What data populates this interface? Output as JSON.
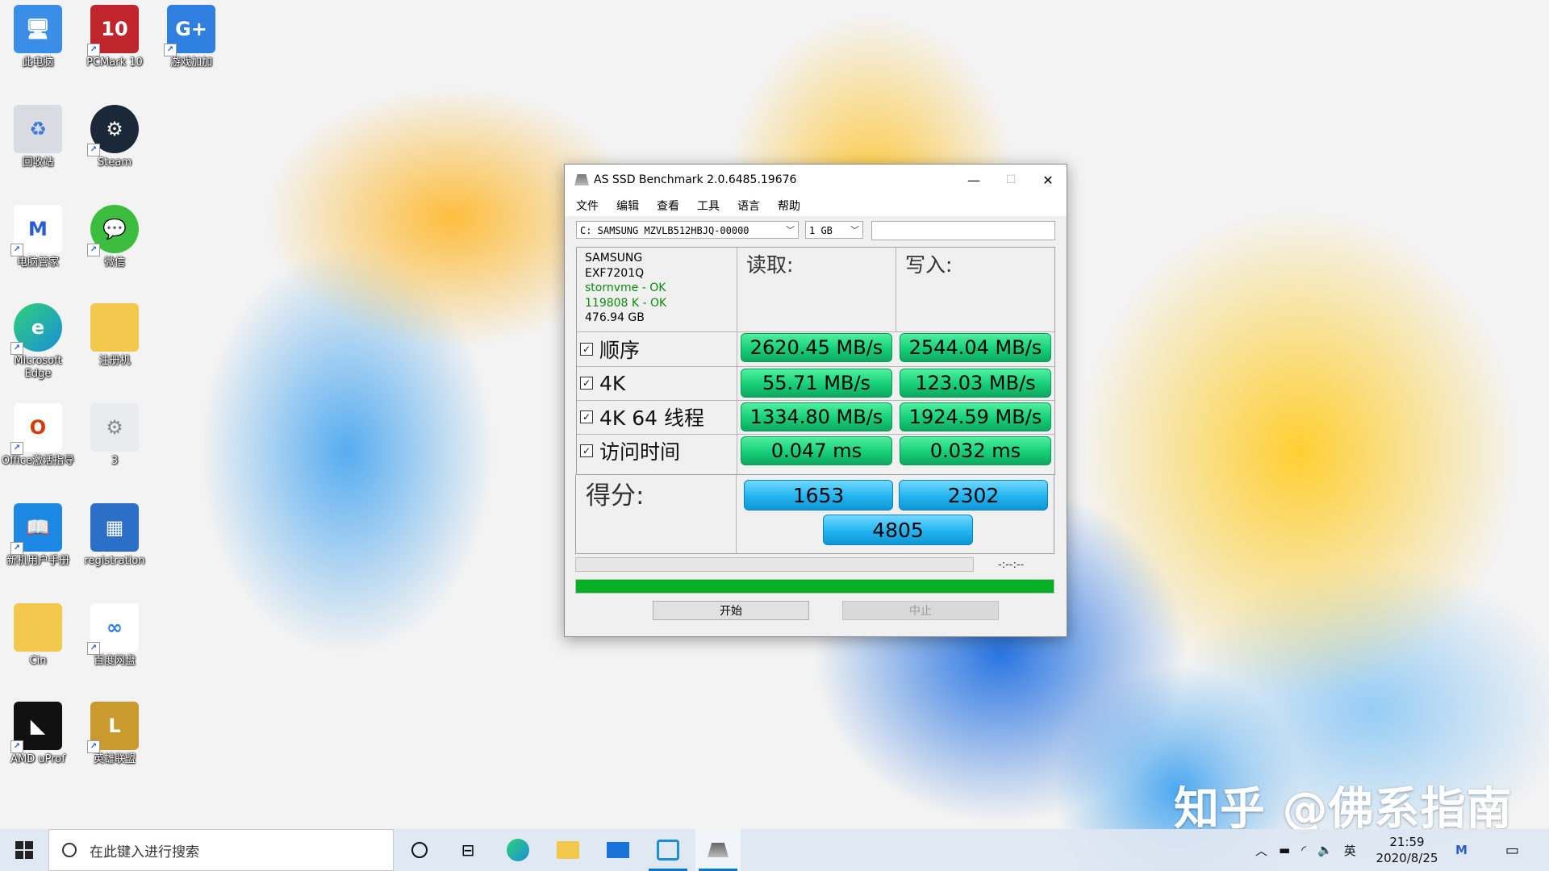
{
  "desktop": {
    "icons": [
      {
        "label": "此电脑",
        "icon": "computer-icon",
        "color": "#3b8ee8"
      },
      {
        "label": "PCMark 10",
        "icon": "pcmark-icon",
        "color": "#c0242c"
      },
      {
        "label": "游戏加加",
        "icon": "game-booster-icon",
        "color": "#2f7fe0"
      },
      {
        "label": "回收站",
        "icon": "recycle-bin-icon",
        "color": "#d9dde3"
      },
      {
        "label": "Steam",
        "icon": "steam-icon",
        "color": "#1b2838"
      },
      {
        "label": "电脑管家",
        "icon": "pc-manager-icon",
        "color": "#2a5bd6"
      },
      {
        "label": "微信",
        "icon": "wechat-icon",
        "color": "#3dbd3d"
      },
      {
        "label": "Microsoft Edge",
        "icon": "edge-icon",
        "color": "#1a8fd6"
      },
      {
        "label": "注册机",
        "icon": "folder-icon",
        "color": "#f2c94c"
      },
      {
        "label": "Office激活指导",
        "icon": "office-icon",
        "color": "#d83b01"
      },
      {
        "label": "3",
        "icon": "settings-file-icon",
        "color": "#c9cdd3"
      },
      {
        "label": "新机用户手册",
        "icon": "manual-icon",
        "color": "#1e88e5"
      },
      {
        "label": "registration",
        "icon": "registration-icon",
        "color": "#2c6fc8"
      },
      {
        "label": "Cin",
        "icon": "folder-icon",
        "color": "#f2c94c"
      },
      {
        "label": "百度网盘",
        "icon": "baidu-netdisk-icon",
        "color": "#2b7bf0"
      },
      {
        "label": "AMD uProf",
        "icon": "amd-icon",
        "color": "#111111"
      },
      {
        "label": "英雄联盟",
        "icon": "lol-icon",
        "color": "#c99a2e"
      }
    ]
  },
  "window": {
    "title": "AS SSD Benchmark 2.0.6485.19676",
    "controls": {
      "minimize": "—",
      "maximize": "☐",
      "close": "✕"
    },
    "menu": [
      "文件",
      "编辑",
      "查看",
      "工具",
      "语言",
      "帮助"
    ],
    "drive_select": "C: SAMSUNG MZVLB512HBJQ-00000",
    "size_select": "1 GB",
    "drive_info": {
      "vendor": "SAMSUNG",
      "firmware": "EXF7201Q",
      "driver": "stornvme - OK",
      "alignment": "119808 K - OK",
      "capacity": "476.94 GB"
    },
    "headers": {
      "read": "读取:",
      "write": "写入:"
    },
    "rows": [
      {
        "label": "顺序",
        "read": "2620.45 MB/s",
        "write": "2544.04 MB/s"
      },
      {
        "label": "4K",
        "read": "55.71 MB/s",
        "write": "123.03 MB/s"
      },
      {
        "label": "4K 64 线程",
        "read": "1334.80 MB/s",
        "write": "1924.59 MB/s"
      },
      {
        "label": "访问时间",
        "read": "0.047 ms",
        "write": "0.032 ms"
      }
    ],
    "score": {
      "label": "得分:",
      "read": "1653",
      "write": "2302",
      "total": "4805"
    },
    "timer": "-:--:--",
    "progress": 1.0,
    "buttons": {
      "start": "开始",
      "abort": "中止"
    },
    "colors": {
      "result_green": "#16cf78",
      "score_blue": "#22b4ef",
      "progress_green": "#06b025"
    }
  },
  "taskbar": {
    "search_placeholder": "在此键入进行搜索",
    "tray": {
      "ime": "英",
      "time": "21:59",
      "date": "2020/8/25"
    }
  },
  "watermark": "知乎 @佛系指南"
}
